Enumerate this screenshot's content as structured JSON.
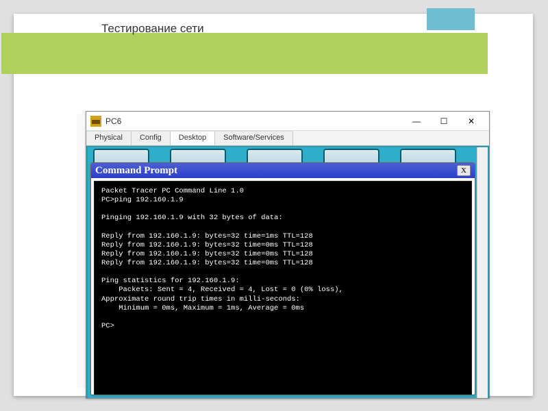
{
  "slide": {
    "title": "Тестирование сети"
  },
  "window": {
    "title": "PC6",
    "controls": {
      "min": "—",
      "max": "☐",
      "close": "✕"
    },
    "tabs": [
      "Physical",
      "Config",
      "Desktop",
      "Software/Services"
    ],
    "active_tab_index": 2
  },
  "cmd": {
    "title": "Command Prompt",
    "close": "X",
    "lines": "Packet Tracer PC Command Line 1.0\nPC>ping 192.160.1.9\n\nPinging 192.160.1.9 with 32 bytes of data:\n\nReply from 192.160.1.9: bytes=32 time=1ms TTL=128\nReply from 192.160.1.9: bytes=32 time=0ms TTL=128\nReply from 192.160.1.9: bytes=32 time=0ms TTL=128\nReply from 192.160.1.9: bytes=32 time=0ms TTL=128\n\nPing statistics for 192.160.1.9:\n    Packets: Sent = 4, Received = 4, Lost = 0 (0% loss),\nApproximate round trip times in milli-seconds:\n    Minimum = 0ms, Maximum = 1ms, Average = 0ms\n\nPC>"
  }
}
